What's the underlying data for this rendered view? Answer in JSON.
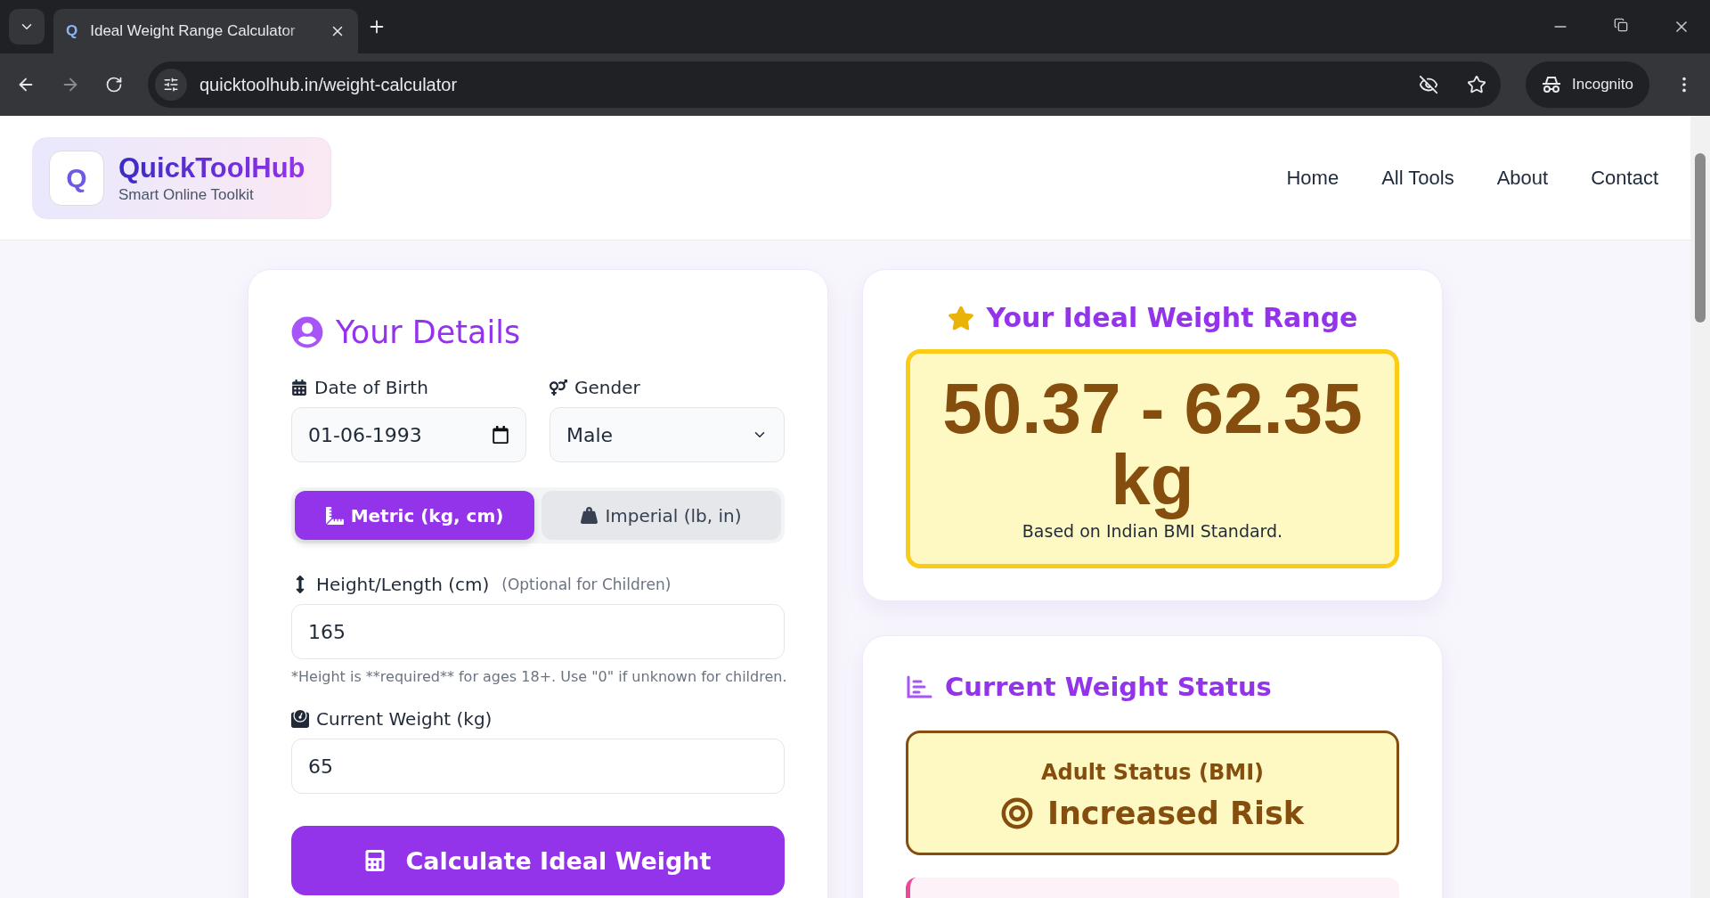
{
  "browser": {
    "favicon": "Q",
    "tab_title": "Ideal Weight Range Calculator",
    "address": "quicktoolhub.in/weight-calculator",
    "profile": "Incognito"
  },
  "header": {
    "logo_letter": "Q",
    "brand": "QuickToolHub",
    "tagline": "Smart Online Toolkit",
    "nav": [
      "Home",
      "All Tools",
      "About",
      "Contact"
    ]
  },
  "details": {
    "title": "Your Details",
    "dob": {
      "label": "Date of Birth",
      "value": "01-06-1993"
    },
    "gender": {
      "label": "Gender",
      "value": "Male"
    },
    "units": [
      {
        "kind": "metric",
        "label": "Metric (kg, cm)",
        "selected": true
      },
      {
        "kind": "imperial",
        "label": "Imperial (lb, in)",
        "selected": false
      }
    ],
    "height": {
      "label": "Height/Length (cm)",
      "hint": "(Optional for Children)",
      "value": "165",
      "note": "*Height is **required** for ages 18+. Use \"0\" if unknown for children."
    },
    "weight": {
      "label": "Current Weight (kg)",
      "value": "65"
    },
    "button": "Calculate Ideal Weight"
  },
  "result": {
    "title": "Your Ideal Weight Range",
    "range": "50.37 - 62.35 kg",
    "basis": "Based on Indian BMI Standard."
  },
  "status": {
    "title": "Current Weight Status",
    "heading": "Adult Status (BMI)",
    "value": "Increased Risk"
  }
}
